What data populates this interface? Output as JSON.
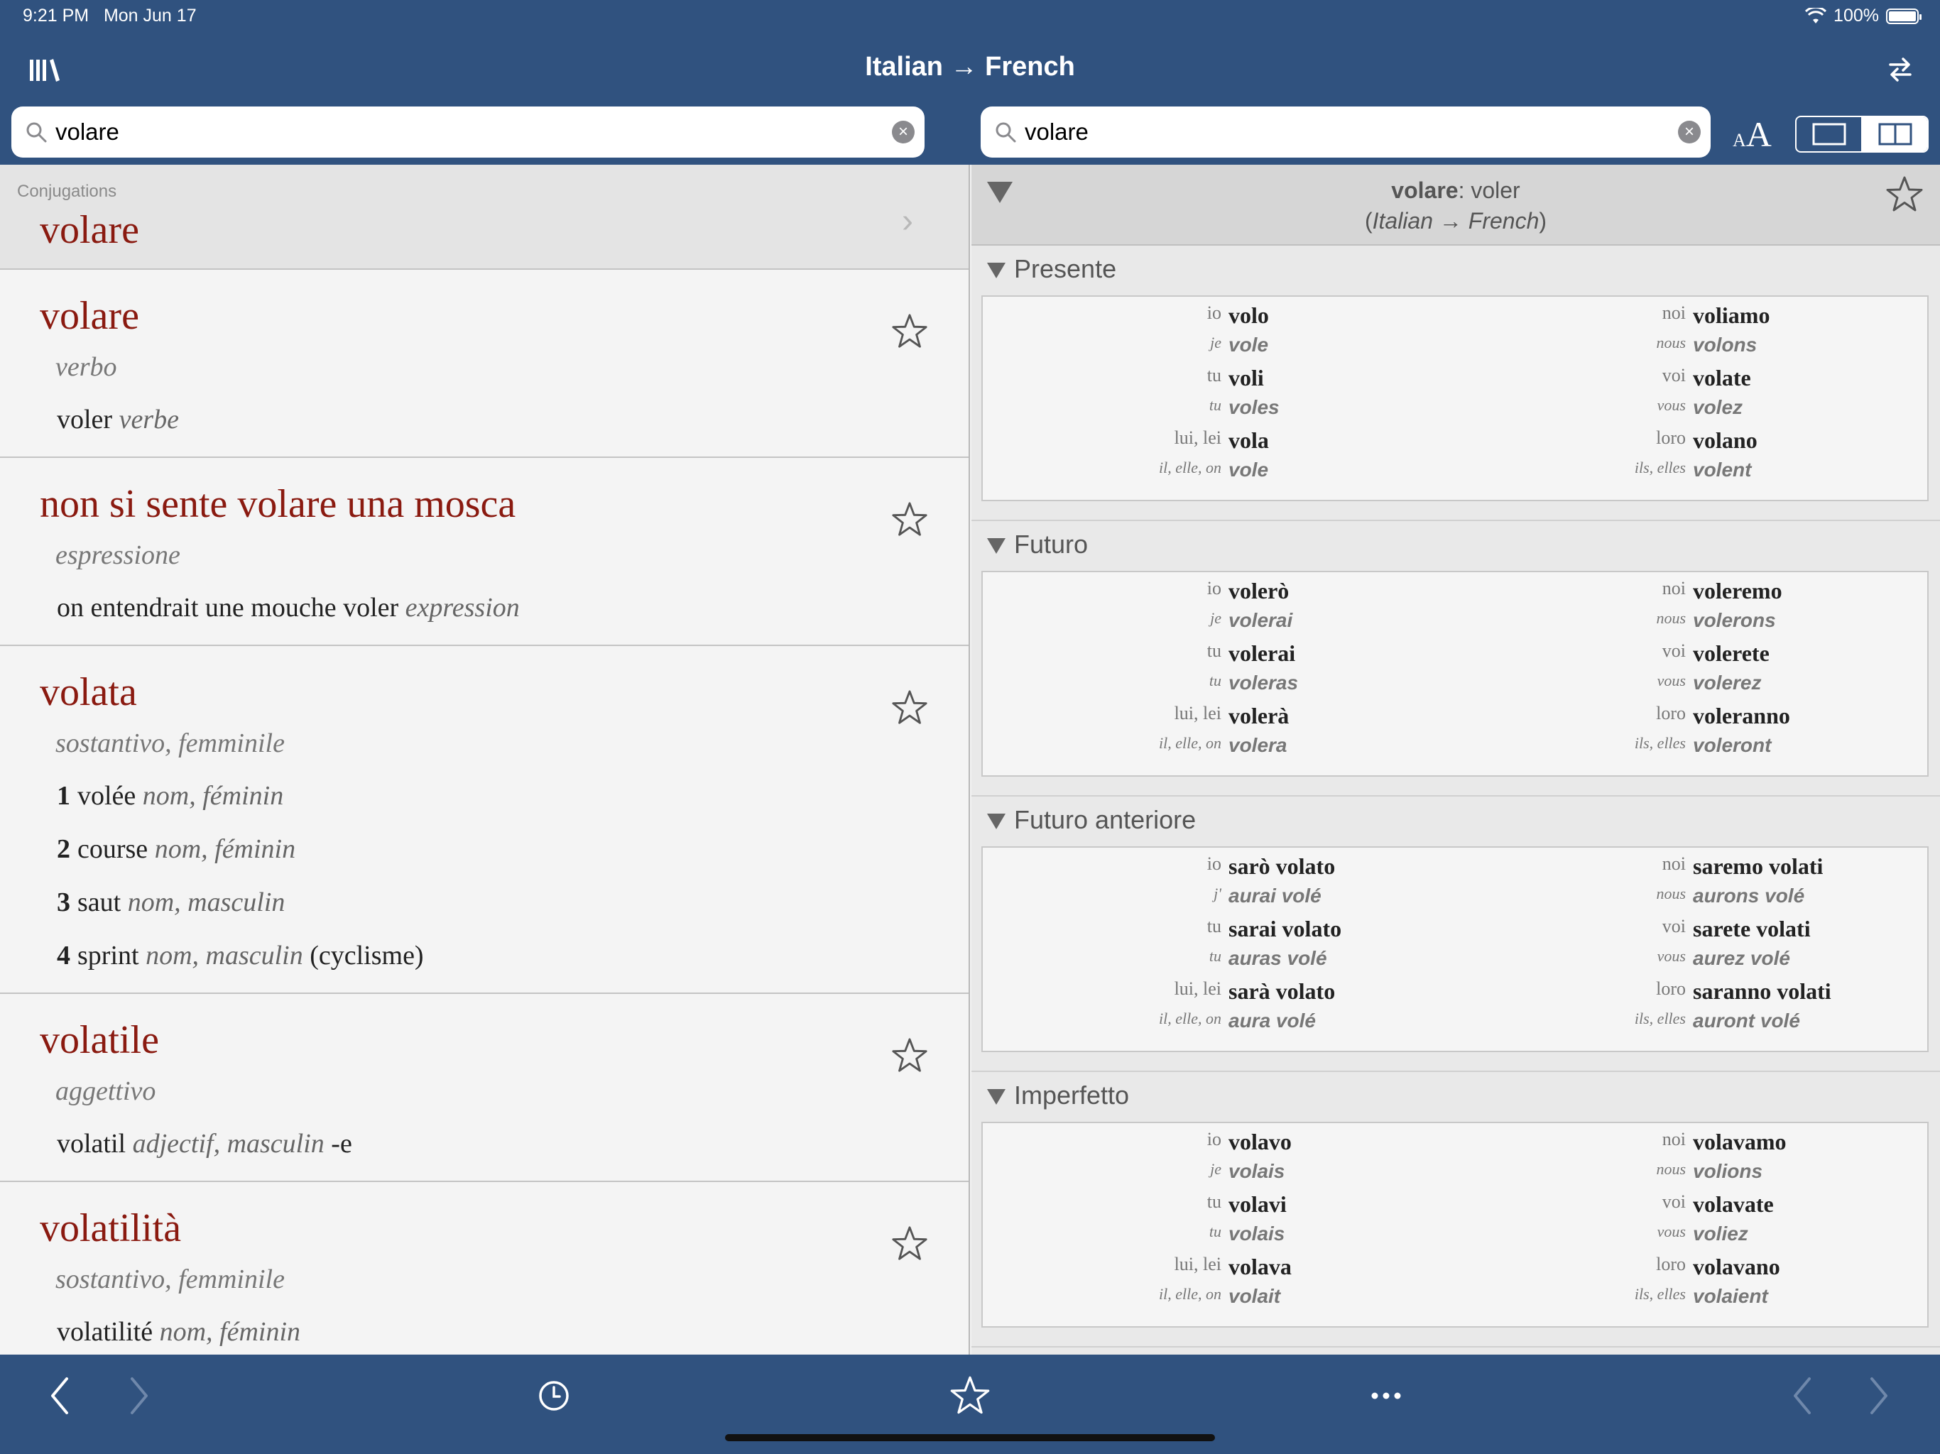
{
  "status_bar": {
    "time": "9:21 PM",
    "date": "Mon Jun 17",
    "battery": "100%"
  },
  "header": {
    "title": "Italian → French"
  },
  "left_search": {
    "value": "volare"
  },
  "right_search": {
    "value": "volare"
  },
  "font_size_button": {
    "small": "A",
    "big": "A"
  },
  "conjugations_row": {
    "category": "Conjugations",
    "headword": "volare"
  },
  "entries": [
    {
      "headword": "volare",
      "pos": "verbo",
      "translations": [
        {
          "num": "",
          "word": "voler",
          "gram": "verbe",
          "extra": ""
        }
      ]
    },
    {
      "headword": "non si sente volare una mosca",
      "pos": "espressione",
      "translations": [
        {
          "num": "",
          "word": "on entendrait une mouche voler",
          "gram": "expression",
          "extra": ""
        }
      ]
    },
    {
      "headword": "volata",
      "pos": "sostantivo, femminile",
      "translations": [
        {
          "num": "1",
          "word": "volée",
          "gram": "nom, féminin",
          "extra": ""
        },
        {
          "num": "2",
          "word": "course",
          "gram": "nom, féminin",
          "extra": ""
        },
        {
          "num": "3",
          "word": "saut",
          "gram": "nom, masculin",
          "extra": ""
        },
        {
          "num": "4",
          "word": "sprint",
          "gram": "nom, masculin",
          "extra": "(cyclisme)"
        }
      ]
    },
    {
      "headword": "volatile",
      "pos": "aggettivo",
      "translations": [
        {
          "num": "",
          "word": "volatil",
          "gram": "adjectif, masculin",
          "extra": "-e"
        }
      ]
    },
    {
      "headword": "volatilità",
      "pos": "sostantivo, femminile",
      "translations": [
        {
          "num": "",
          "word": "volatilité",
          "gram": "nom, féminin",
          "extra": ""
        }
      ]
    }
  ],
  "detail": {
    "headword": "volare",
    "translation": "voler",
    "direction": "Italian → French",
    "tenses": [
      {
        "name": "Presente",
        "left": [
          {
            "pr": "io",
            "v": "volo"
          },
          {
            "pr": "je",
            "v": "vole"
          },
          {
            "pr": "tu",
            "v": "voli"
          },
          {
            "pr": "tu",
            "v": "voles"
          },
          {
            "pr": "lui, lei",
            "v": "vola"
          },
          {
            "pr": "il, elle, on",
            "v": "vole"
          }
        ],
        "right": [
          {
            "pr": "noi",
            "v": "voliamo"
          },
          {
            "pr": "nous",
            "v": "volons"
          },
          {
            "pr": "voi",
            "v": "volate"
          },
          {
            "pr": "vous",
            "v": "volez"
          },
          {
            "pr": "loro",
            "v": "volano"
          },
          {
            "pr": "ils, elles",
            "v": "volent"
          }
        ]
      },
      {
        "name": "Futuro",
        "left": [
          {
            "pr": "io",
            "v": "volerò"
          },
          {
            "pr": "je",
            "v": "volerai"
          },
          {
            "pr": "tu",
            "v": "volerai"
          },
          {
            "pr": "tu",
            "v": "voleras"
          },
          {
            "pr": "lui, lei",
            "v": "volerà"
          },
          {
            "pr": "il, elle, on",
            "v": "volera"
          }
        ],
        "right": [
          {
            "pr": "noi",
            "v": "voleremo"
          },
          {
            "pr": "nous",
            "v": "volerons"
          },
          {
            "pr": "voi",
            "v": "volerete"
          },
          {
            "pr": "vous",
            "v": "volerez"
          },
          {
            "pr": "loro",
            "v": "voleranno"
          },
          {
            "pr": "ils, elles",
            "v": "voleront"
          }
        ]
      },
      {
        "name": "Futuro anteriore",
        "left": [
          {
            "pr": "io",
            "v": "sarò volato"
          },
          {
            "pr": "j'",
            "v": "aurai volé"
          },
          {
            "pr": "tu",
            "v": "sarai volato"
          },
          {
            "pr": "tu",
            "v": "auras volé"
          },
          {
            "pr": "lui, lei",
            "v": "sarà volato"
          },
          {
            "pr": "il, elle, on",
            "v": "aura volé"
          }
        ],
        "right": [
          {
            "pr": "noi",
            "v": "saremo volati"
          },
          {
            "pr": "nous",
            "v": "aurons volé"
          },
          {
            "pr": "voi",
            "v": "sarete volati"
          },
          {
            "pr": "vous",
            "v": "aurez volé"
          },
          {
            "pr": "loro",
            "v": "saranno volati"
          },
          {
            "pr": "ils, elles",
            "v": "auront volé"
          }
        ]
      },
      {
        "name": "Imperfetto",
        "left": [
          {
            "pr": "io",
            "v": "volavo"
          },
          {
            "pr": "je",
            "v": "volais"
          },
          {
            "pr": "tu",
            "v": "volavi"
          },
          {
            "pr": "tu",
            "v": "volais"
          },
          {
            "pr": "lui, lei",
            "v": "volava"
          },
          {
            "pr": "il, elle, on",
            "v": "volait"
          }
        ],
        "right": [
          {
            "pr": "noi",
            "v": "volavamo"
          },
          {
            "pr": "nous",
            "v": "volions"
          },
          {
            "pr": "voi",
            "v": "volavate"
          },
          {
            "pr": "vous",
            "v": "voliez"
          },
          {
            "pr": "loro",
            "v": "volavano"
          },
          {
            "pr": "ils, elles",
            "v": "volaient"
          }
        ]
      }
    ]
  },
  "toolbar_icons": [
    "back-icon",
    "forward-icon",
    "history-clock-icon",
    "favorite-star-icon",
    "more-ellipsis-icon",
    "prev-entry-icon",
    "next-entry-icon"
  ],
  "colors": {
    "bar": "#30527f",
    "headword": "#8a1a10"
  }
}
